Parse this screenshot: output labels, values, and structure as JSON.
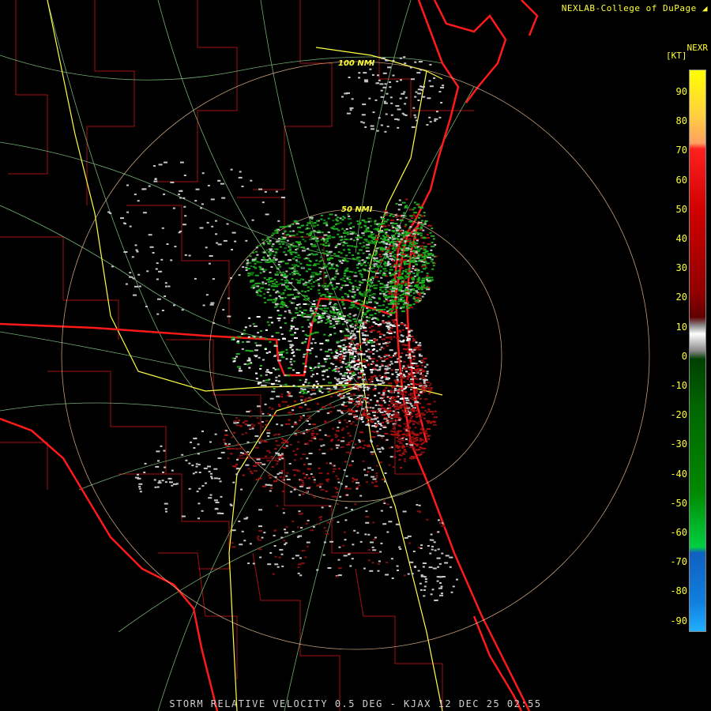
{
  "credit": "NEXLAB-College of DuPage",
  "legend": {
    "product": "NEXR",
    "unit": "[KT]",
    "ticks": [
      "90",
      "80",
      "70",
      "60",
      "50",
      "40",
      "30",
      "20",
      "10",
      "0",
      "-10",
      "-20",
      "-30",
      "-40",
      "-50",
      "-60",
      "-70",
      "-80",
      "-90"
    ]
  },
  "rings": {
    "inner": "50 NMI",
    "outer": "100 NMI"
  },
  "footer": "STORM RELATIVE VELOCITY 0.5 DEG - KJAX 12 DEC 25 02:55",
  "colors": {
    "inbound": "#1fae1f",
    "outbound": "#b01010",
    "near_zero": "#c8c8c8",
    "state_line": "#ff1a1a",
    "county_line": "#a01010",
    "highway": "#ffff44",
    "road": "#88cc88",
    "ring": "#ffd0a0"
  }
}
